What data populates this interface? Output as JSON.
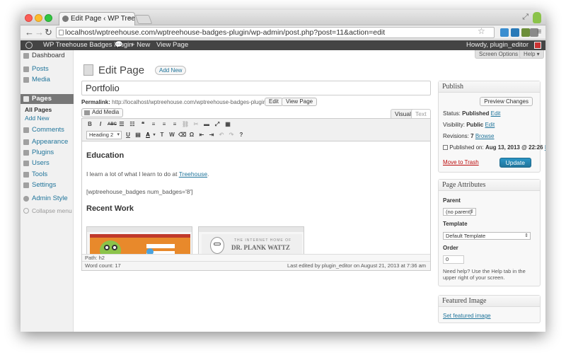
{
  "browser": {
    "tab_title": "Edit Page ‹ WP Treehouse B...",
    "tab_close": "×",
    "url": "localhost/wptreehouse.com/wptreehouse-badges-plugin/wp-admin/post.php?post=11&action=edit",
    "resize_glyph": "⤢"
  },
  "admin_bar": {
    "site_name": "WP Treehouse Badges Plugin",
    "new_label": "+  New",
    "view_page": "View Page",
    "howdy": "Howdy, plugin_editor"
  },
  "sidebar": {
    "items": [
      {
        "label": "Dashboard"
      },
      {
        "label": "Posts"
      },
      {
        "label": "Media"
      },
      {
        "label": "Pages"
      },
      {
        "label": "Comments"
      },
      {
        "label": "Appearance"
      },
      {
        "label": "Plugins"
      },
      {
        "label": "Users"
      },
      {
        "label": "Tools"
      },
      {
        "label": "Settings"
      },
      {
        "label": "Admin Style"
      }
    ],
    "sub_items": [
      "All Pages",
      "Add New"
    ],
    "collapse": "Collapse menu"
  },
  "header": {
    "screen_options": "Screen Options ▾",
    "help": "Help ▾",
    "title": "Edit Page",
    "add_new": "Add New"
  },
  "post": {
    "title": "Portfolio",
    "permalink_label": "Permalink:",
    "permalink_base": "http://localhost/wptreehouse.com/wptreehouse-badges-plugin/",
    "permalink_slug": "portfolio",
    "permalink_end": "/",
    "edit_btn": "Edit",
    "view_page_btn": "View Page"
  },
  "editor": {
    "add_media": "Add Media",
    "tab_visual": "Visual",
    "tab_text": "Text",
    "format": "Heading 2",
    "heading1": "Education",
    "para1_before": "I learn a lot of what I learn to do at ",
    "para1_link": "Treehouse",
    "para1_after": ".",
    "shortcode": "[wptreehouse_badges num_badges='8']",
    "heading2": "Recent Work",
    "thumb2_line1": "THE INTERNET HOME OF",
    "thumb2_line2": "DR. PLANK WATTZ",
    "path": "Path: h2",
    "word_count": "Word count: 17",
    "last_edited": "Last edited by plugin_editor on August 21, 2013 at 7:36 am"
  },
  "publish_box": {
    "title": "Publish",
    "preview": "Preview Changes",
    "status_label": "Status:",
    "status_value": "Published",
    "visibility_label": "Visibility:",
    "visibility_value": "Public",
    "revisions_label": "Revisions:",
    "revisions_value": "7",
    "browse": "Browse",
    "published_on_label": "Published on:",
    "published_on_value": "Aug 13, 2013 @ 22:26",
    "edit": "Edit",
    "trash": "Move to Trash",
    "update": "Update"
  },
  "attributes_box": {
    "title": "Page Attributes",
    "parent_label": "Parent",
    "parent_value": "(no parent)",
    "template_label": "Template",
    "template_value": "Default Template",
    "order_label": "Order",
    "order_value": "0",
    "help": "Need help? Use the Help tab in the upper right of your screen."
  },
  "featured_box": {
    "title": "Featured Image",
    "link": "Set featured image"
  },
  "colors": {
    "link": "#21759b",
    "admin_bar": "#444444",
    "active_menu": "#777777",
    "primary_button": "#21759b",
    "trash": "#bc0b0b"
  }
}
